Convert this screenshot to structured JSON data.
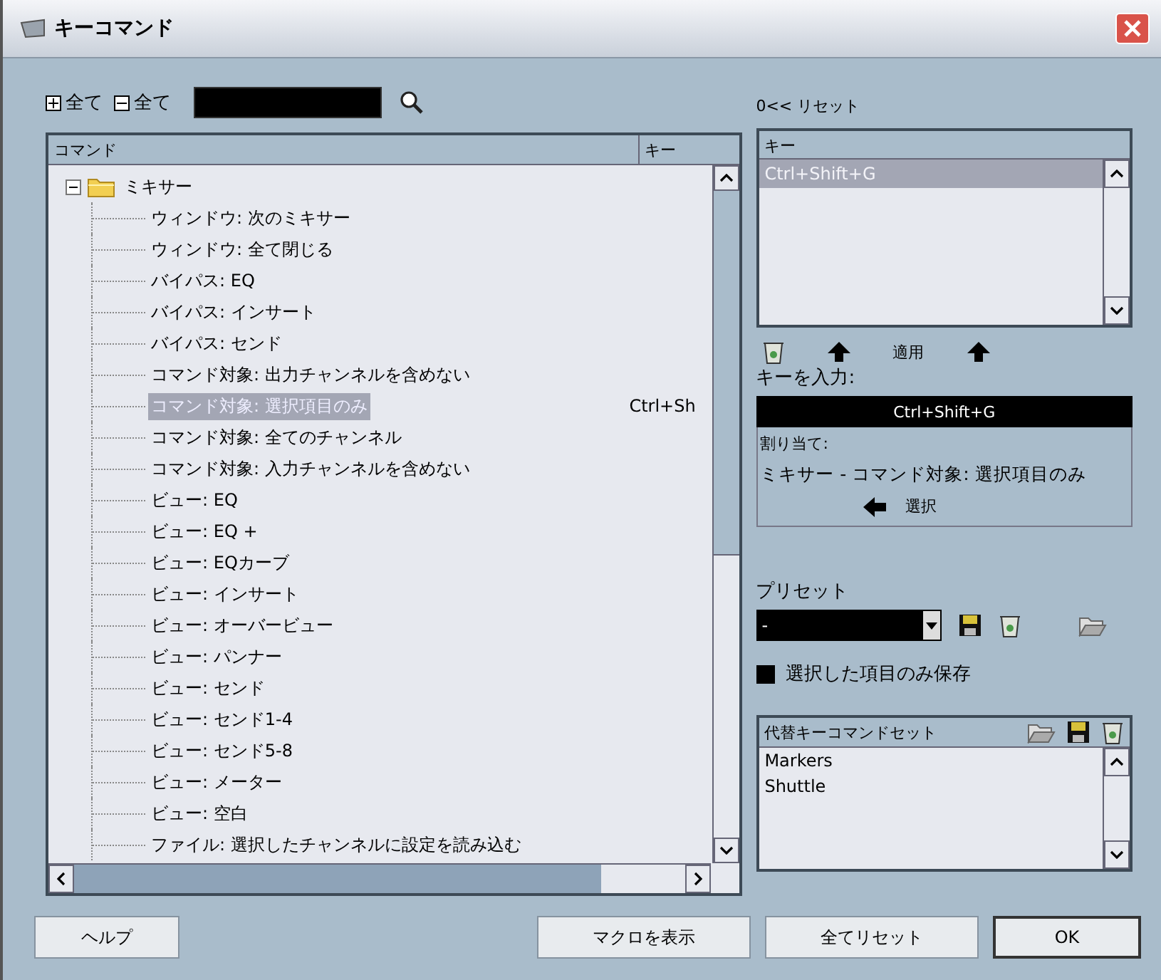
{
  "window": {
    "title": "キーコマンド"
  },
  "toolbar": {
    "expand_all": "全て",
    "collapse_all": "全て"
  },
  "tree": {
    "columns": [
      "コマンド",
      "キー"
    ],
    "folders": [
      {
        "label": "ミキサー",
        "expanded": true,
        "children": [
          {
            "label": "ウィンドウ: 次のミキサー",
            "selected": false
          },
          {
            "label": "ウィンドウ: 全て閉じる",
            "selected": false
          },
          {
            "label": "バイパス: EQ",
            "selected": false
          },
          {
            "label": "バイパス: インサート",
            "selected": false
          },
          {
            "label": "バイパス: センド",
            "selected": false
          },
          {
            "label": "コマンド対象: 出力チャンネルを含めない",
            "selected": false
          },
          {
            "label": "コマンド対象: 選択項目のみ",
            "key": "Ctrl+Sh",
            "selected": true
          },
          {
            "label": "コマンド対象: 全てのチャンネル",
            "selected": false
          },
          {
            "label": "コマンド対象: 入力チャンネルを含めない",
            "selected": false
          },
          {
            "label": "ビュー: EQ",
            "selected": false
          },
          {
            "label": "ビュー: EQ +",
            "selected": false
          },
          {
            "label": "ビュー: EQカーブ",
            "selected": false
          },
          {
            "label": "ビュー: インサート",
            "selected": false
          },
          {
            "label": "ビュー: オーバービュー",
            "selected": false
          },
          {
            "label": "ビュー: パンナー",
            "selected": false
          },
          {
            "label": "ビュー: センド",
            "selected": false
          },
          {
            "label": "ビュー: センド1-4",
            "selected": false
          },
          {
            "label": "ビュー: センド5-8",
            "selected": false
          },
          {
            "label": "ビュー: メーター",
            "selected": false
          },
          {
            "label": "ビュー: 空白",
            "selected": false
          },
          {
            "label": "ファイル: 選択したチャンネルに設定を読み込む",
            "selected": false
          }
        ]
      }
    ]
  },
  "reset": "0<< リセット",
  "keys": {
    "column": "キー",
    "items": [
      {
        "label": "Ctrl+Shift+G",
        "selected": true
      }
    ]
  },
  "apply": "適用",
  "key_input": {
    "label": "キーを入力:",
    "value": "Ctrl+Shift+G"
  },
  "assigned": {
    "label": "割り当て:",
    "value": "ミキサー - コマンド対象: 選択項目のみ",
    "select": "選択"
  },
  "preset": {
    "label": "プリセット",
    "value": "-"
  },
  "save_selected_only": {
    "label": "選択した項目のみ保存",
    "checked": true
  },
  "alt_sets": {
    "title": "代替キーコマンドセット",
    "items": [
      "Markers",
      "Shuttle"
    ]
  },
  "buttons": {
    "help": "ヘルプ",
    "macros": "マクロを表示",
    "reset_all": "全てリセット",
    "ok": "OK"
  }
}
